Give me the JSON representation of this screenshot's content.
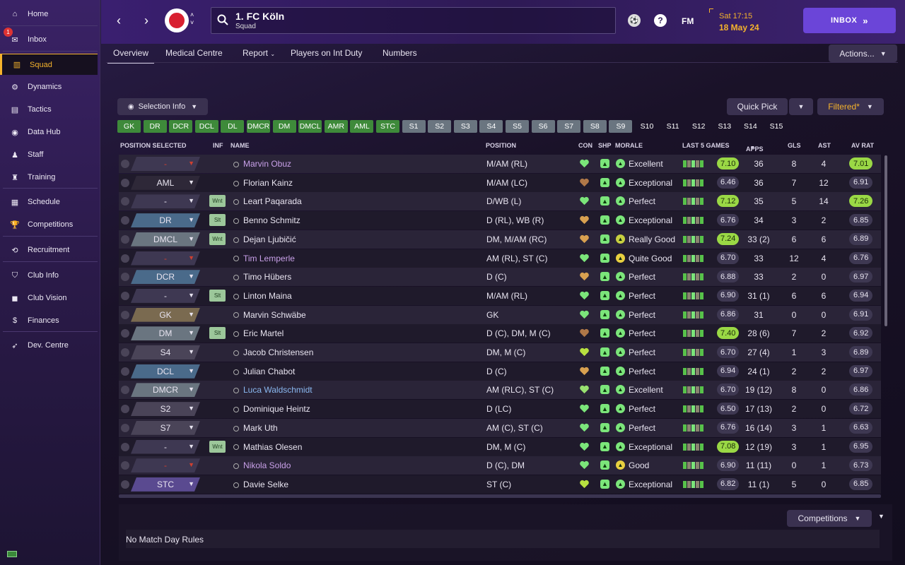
{
  "sidebar": {
    "items": [
      {
        "label": "Home",
        "icon": "home-icon"
      },
      {
        "label": "Inbox",
        "icon": "inbox-icon",
        "badge": "1"
      },
      {
        "label": "Squad",
        "icon": "squad-icon"
      },
      {
        "label": "Dynamics",
        "icon": "dynamics-icon"
      },
      {
        "label": "Tactics",
        "icon": "tactics-icon"
      },
      {
        "label": "Data Hub",
        "icon": "data-hub-icon"
      },
      {
        "label": "Staff",
        "icon": "staff-icon"
      },
      {
        "label": "Training",
        "icon": "training-icon"
      },
      {
        "label": "Schedule",
        "icon": "schedule-icon"
      },
      {
        "label": "Competitions",
        "icon": "trophy-icon"
      },
      {
        "label": "Recruitment",
        "icon": "recruitment-icon"
      },
      {
        "label": "Club Info",
        "icon": "shield-icon"
      },
      {
        "label": "Club Vision",
        "icon": "briefcase-icon"
      },
      {
        "label": "Finances",
        "icon": "finances-icon"
      },
      {
        "label": "Dev. Centre",
        "icon": "dev-centre-icon"
      }
    ]
  },
  "header": {
    "club_name": "1. FC Köln",
    "subtitle": "Squad",
    "time": "Sat 17:15",
    "date": "18 May 24",
    "inbox_label": "INBOX",
    "fm_label": "FM",
    "help_label": "?"
  },
  "tabs": [
    "Overview",
    "Medical Centre",
    "Report",
    "Players on Int Duty",
    "Numbers"
  ],
  "actions_label": "Actions...",
  "selection_info_label": "Selection Info",
  "quick_pick_label": "Quick Pick",
  "filtered_label": "Filtered*",
  "position_filters": [
    {
      "label": "GK",
      "style": "green"
    },
    {
      "label": "DR",
      "style": "green"
    },
    {
      "label": "DCR",
      "style": "green"
    },
    {
      "label": "DCL",
      "style": "green"
    },
    {
      "label": "DL",
      "style": "green"
    },
    {
      "label": "DMCR",
      "style": "green"
    },
    {
      "label": "DM",
      "style": "green"
    },
    {
      "label": "DMCL",
      "style": "green"
    },
    {
      "label": "AMR",
      "style": "green"
    },
    {
      "label": "AML",
      "style": "green"
    },
    {
      "label": "STC",
      "style": "green"
    },
    {
      "label": "S1",
      "style": "grey"
    },
    {
      "label": "S2",
      "style": "grey"
    },
    {
      "label": "S3",
      "style": "grey"
    },
    {
      "label": "S4",
      "style": "grey"
    },
    {
      "label": "S5",
      "style": "grey"
    },
    {
      "label": "S6",
      "style": "grey"
    },
    {
      "label": "S7",
      "style": "grey"
    },
    {
      "label": "S8",
      "style": "grey"
    },
    {
      "label": "S9",
      "style": "grey"
    },
    {
      "label": "S10",
      "style": "dark"
    },
    {
      "label": "S11",
      "style": "dark"
    },
    {
      "label": "S12",
      "style": "dark"
    },
    {
      "label": "S13",
      "style": "dark"
    },
    {
      "label": "S14",
      "style": "dark"
    },
    {
      "label": "S15",
      "style": "dark"
    }
  ],
  "table": {
    "headers": {
      "position_selected": "POSITION SELECTED",
      "inf": "INF",
      "name": "NAME",
      "position": "POSITION",
      "con": "CON",
      "shp": "SHP",
      "morale": "MORALE",
      "last5": "LAST 5 GAMES",
      "apps": "APPS",
      "gls": "GLS",
      "ast": "AST",
      "avrat": "AV RAT"
    },
    "rows": [
      {
        "sel": "-",
        "sel_color": "#3e3852",
        "sel_text": "#d04030",
        "inf": "",
        "name": "Marvin Obuz",
        "name_color": "#c8a0e8",
        "position": "M/AM (RL)",
        "con": "#7be57a",
        "morale": "Excellent",
        "morale_color": "#7be57a",
        "rating": "7.10",
        "rating_hi": true,
        "apps": "36",
        "gls": "8",
        "ast": "4",
        "avrat": "7.01",
        "av_hi": true
      },
      {
        "sel": "AML",
        "sel_color": "#2e2838",
        "sel_text": "#e8e4f0",
        "inf": "",
        "name": "Florian Kainz",
        "name_color": "#e8e4f0",
        "position": "M/AM (LC)",
        "con": "#b07848",
        "morale": "Exceptional",
        "morale_color": "#7be57a",
        "rating": "6.46",
        "rating_hi": false,
        "apps": "36",
        "gls": "7",
        "ast": "12",
        "avrat": "6.91",
        "av_hi": false
      },
      {
        "sel": "-",
        "sel_color": "#3e3852",
        "sel_text": "#e8e4f0",
        "inf": "Wnt",
        "name": "Leart Paqarada",
        "name_color": "#e8e4f0",
        "position": "D/WB (L)",
        "con": "#7be57a",
        "morale": "Perfect",
        "morale_color": "#7be57a",
        "rating": "7.12",
        "rating_hi": true,
        "apps": "35",
        "gls": "5",
        "ast": "14",
        "avrat": "7.26",
        "av_hi": true
      },
      {
        "sel": "DR",
        "sel_color": "#4a6a8a",
        "sel_text": "#e8e4f0",
        "inf": "Slt",
        "name": "Benno Schmitz",
        "name_color": "#e8e4f0",
        "position": "D (RL), WB (R)",
        "con": "#d8a050",
        "morale": "Exceptional",
        "morale_color": "#7be57a",
        "rating": "6.76",
        "rating_hi": false,
        "apps": "34",
        "gls": "3",
        "ast": "2",
        "avrat": "6.85",
        "av_hi": false
      },
      {
        "sel": "DMCL",
        "sel_color": "#6a7580",
        "sel_text": "#e8e4f0",
        "inf": "Wnt",
        "name": "Dejan Ljubičić",
        "name_color": "#e8e4f0",
        "position": "DM, M/AM (RC)",
        "con": "#d8a050",
        "morale": "Really Good",
        "morale_color": "#c8d040",
        "rating": "7.24",
        "rating_hi": true,
        "apps": "33 (2)",
        "gls": "6",
        "ast": "6",
        "avrat": "6.89",
        "av_hi": false
      },
      {
        "sel": "-",
        "sel_color": "#3e3852",
        "sel_text": "#d04030",
        "inf": "",
        "name": "Tim Lemperle",
        "name_color": "#c8a0e8",
        "position": "AM (RL), ST (C)",
        "con": "#7be57a",
        "morale": "Quite Good",
        "morale_color": "#e8d040",
        "rating": "6.70",
        "rating_hi": false,
        "apps": "33",
        "gls": "12",
        "ast": "4",
        "avrat": "6.76",
        "av_hi": false
      },
      {
        "sel": "DCR",
        "sel_color": "#4a6a8a",
        "sel_text": "#e8e4f0",
        "inf": "",
        "name": "Timo Hübers",
        "name_color": "#e8e4f0",
        "position": "D (C)",
        "con": "#d8a050",
        "morale": "Perfect",
        "morale_color": "#7be57a",
        "rating": "6.88",
        "rating_hi": false,
        "apps": "33",
        "gls": "2",
        "ast": "0",
        "avrat": "6.97",
        "av_hi": false
      },
      {
        "sel": "-",
        "sel_color": "#3e3852",
        "sel_text": "#e8e4f0",
        "inf": "Slt",
        "name": "Linton Maina",
        "name_color": "#e8e4f0",
        "position": "M/AM (RL)",
        "con": "#7be57a",
        "morale": "Perfect",
        "morale_color": "#7be57a",
        "rating": "6.90",
        "rating_hi": false,
        "apps": "31 (1)",
        "gls": "6",
        "ast": "6",
        "avrat": "6.94",
        "av_hi": false
      },
      {
        "sel": "GK",
        "sel_color": "#7a6a50",
        "sel_text": "#e8e4f0",
        "inf": "",
        "name": "Marvin Schwäbe",
        "name_color": "#e8e4f0",
        "position": "GK",
        "con": "#7be57a",
        "morale": "Perfect",
        "morale_color": "#7be57a",
        "rating": "6.86",
        "rating_hi": false,
        "apps": "31",
        "gls": "0",
        "ast": "0",
        "avrat": "6.91",
        "av_hi": false
      },
      {
        "sel": "DM",
        "sel_color": "#6a7580",
        "sel_text": "#e8e4f0",
        "inf": "Slt",
        "name": "Eric Martel",
        "name_color": "#e8e4f0",
        "position": "D (C), DM, M (C)",
        "con": "#b07848",
        "morale": "Perfect",
        "morale_color": "#7be57a",
        "rating": "7.40",
        "rating_hi": true,
        "apps": "28 (6)",
        "gls": "7",
        "ast": "2",
        "avrat": "6.92",
        "av_hi": false
      },
      {
        "sel": "S4",
        "sel_color": "#4a4458",
        "sel_text": "#e8e4f0",
        "inf": "",
        "name": "Jacob Christensen",
        "name_color": "#e8e4f0",
        "position": "DM, M (C)",
        "con": "#b8e040",
        "morale": "Perfect",
        "morale_color": "#7be57a",
        "rating": "6.70",
        "rating_hi": false,
        "apps": "27 (4)",
        "gls": "1",
        "ast": "3",
        "avrat": "6.89",
        "av_hi": false
      },
      {
        "sel": "DCL",
        "sel_color": "#4a6a8a",
        "sel_text": "#e8e4f0",
        "inf": "",
        "name": "Julian Chabot",
        "name_color": "#e8e4f0",
        "position": "D (C)",
        "con": "#d8a050",
        "morale": "Perfect",
        "morale_color": "#7be57a",
        "rating": "6.94",
        "rating_hi": false,
        "apps": "24 (1)",
        "gls": "2",
        "ast": "2",
        "avrat": "6.97",
        "av_hi": false
      },
      {
        "sel": "DMCR",
        "sel_color": "#6a7580",
        "sel_text": "#e8e4f0",
        "inf": "",
        "name": "Luca Waldschmidt",
        "name_color": "#8ab8f0",
        "position": "AM (RLC), ST (C)",
        "con": "#98e070",
        "morale": "Excellent",
        "morale_color": "#7be57a",
        "rating": "6.70",
        "rating_hi": false,
        "apps": "19 (12)",
        "gls": "8",
        "ast": "0",
        "avrat": "6.86",
        "av_hi": false
      },
      {
        "sel": "S2",
        "sel_color": "#4a4458",
        "sel_text": "#e8e4f0",
        "inf": "",
        "name": "Dominique Heintz",
        "name_color": "#e8e4f0",
        "position": "D (LC)",
        "con": "#7be57a",
        "morale": "Perfect",
        "morale_color": "#7be57a",
        "rating": "6.50",
        "rating_hi": false,
        "apps": "17 (13)",
        "gls": "2",
        "ast": "0",
        "avrat": "6.72",
        "av_hi": false
      },
      {
        "sel": "S7",
        "sel_color": "#4a4458",
        "sel_text": "#e8e4f0",
        "inf": "",
        "name": "Mark Uth",
        "name_color": "#e8e4f0",
        "position": "AM (C), ST (C)",
        "con": "#7be57a",
        "morale": "Perfect",
        "morale_color": "#7be57a",
        "rating": "6.76",
        "rating_hi": false,
        "apps": "16 (14)",
        "gls": "3",
        "ast": "1",
        "avrat": "6.63",
        "av_hi": false
      },
      {
        "sel": "-",
        "sel_color": "#3e3852",
        "sel_text": "#e8e4f0",
        "inf": "Wnt",
        "name": "Mathias Olesen",
        "name_color": "#e8e4f0",
        "position": "DM, M (C)",
        "con": "#7be57a",
        "morale": "Exceptional",
        "morale_color": "#7be57a",
        "rating": "7.08",
        "rating_hi": true,
        "apps": "12 (19)",
        "gls": "3",
        "ast": "1",
        "avrat": "6.95",
        "av_hi": false
      },
      {
        "sel": "-",
        "sel_color": "#3e3852",
        "sel_text": "#d04030",
        "inf": "",
        "name": "Nikola Soldo",
        "name_color": "#c8a0e8",
        "position": "D (C), DM",
        "con": "#7be57a",
        "morale": "Good",
        "morale_color": "#e8d040",
        "rating": "6.90",
        "rating_hi": false,
        "apps": "11 (11)",
        "gls": "0",
        "ast": "1",
        "avrat": "6.73",
        "av_hi": false
      },
      {
        "sel": "STC",
        "sel_color": "#5a4a90",
        "sel_text": "#e8e4f0",
        "inf": "",
        "name": "Davie Selke",
        "name_color": "#e8e4f0",
        "position": "ST (C)",
        "con": "#b8e040",
        "morale": "Exceptional",
        "morale_color": "#7be57a",
        "rating": "6.82",
        "rating_hi": false,
        "apps": "11 (1)",
        "gls": "5",
        "ast": "0",
        "avrat": "6.85",
        "av_hi": false
      }
    ]
  },
  "competitions_label": "Competitions",
  "match_day_rules": "No Match Day Rules"
}
